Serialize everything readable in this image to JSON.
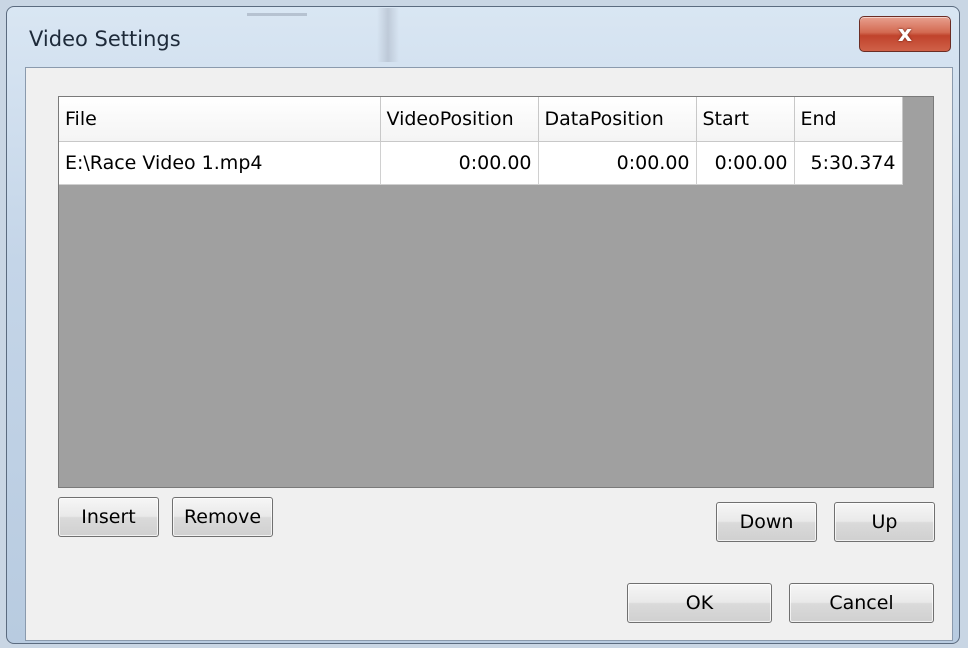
{
  "window": {
    "title": "Video Settings",
    "close_glyph": "x"
  },
  "grid": {
    "columns": [
      "File",
      "VideoPosition",
      "DataPosition",
      "Start",
      "End"
    ],
    "rows": [
      [
        "E:\\Race Video 1.mp4",
        "0:00.00",
        "0:00.00",
        "0:00.00",
        "5:30.374"
      ]
    ]
  },
  "buttons": {
    "insert": "Insert",
    "remove": "Remove",
    "down": "Down",
    "up": "Up",
    "ok": "OK",
    "cancel": "Cancel"
  },
  "colors": {
    "grid_background": "#a0a0a0",
    "close_button": "#c0432c",
    "dialog_background": "#f0f0f0"
  }
}
